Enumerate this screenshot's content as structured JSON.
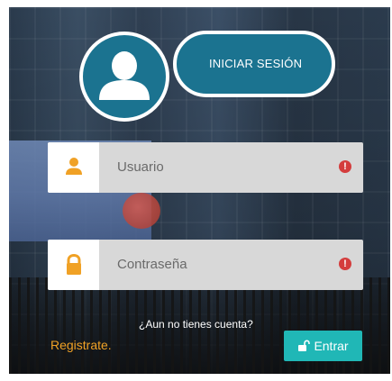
{
  "header": {
    "title": "INICIAR SESIÓN"
  },
  "form": {
    "username": {
      "placeholder": "Usuario",
      "icon": "user-icon"
    },
    "password": {
      "placeholder": "Contraseña",
      "icon": "lock-icon"
    }
  },
  "footer": {
    "question": "¿Aun no tienes cuenta?",
    "register_label": "Registrate.",
    "enter_label": "Entrar"
  },
  "colors": {
    "accent": "#1b7390",
    "input_icon": "#f0a125",
    "alert": "#d43d3d",
    "button": "#20b7b6"
  }
}
